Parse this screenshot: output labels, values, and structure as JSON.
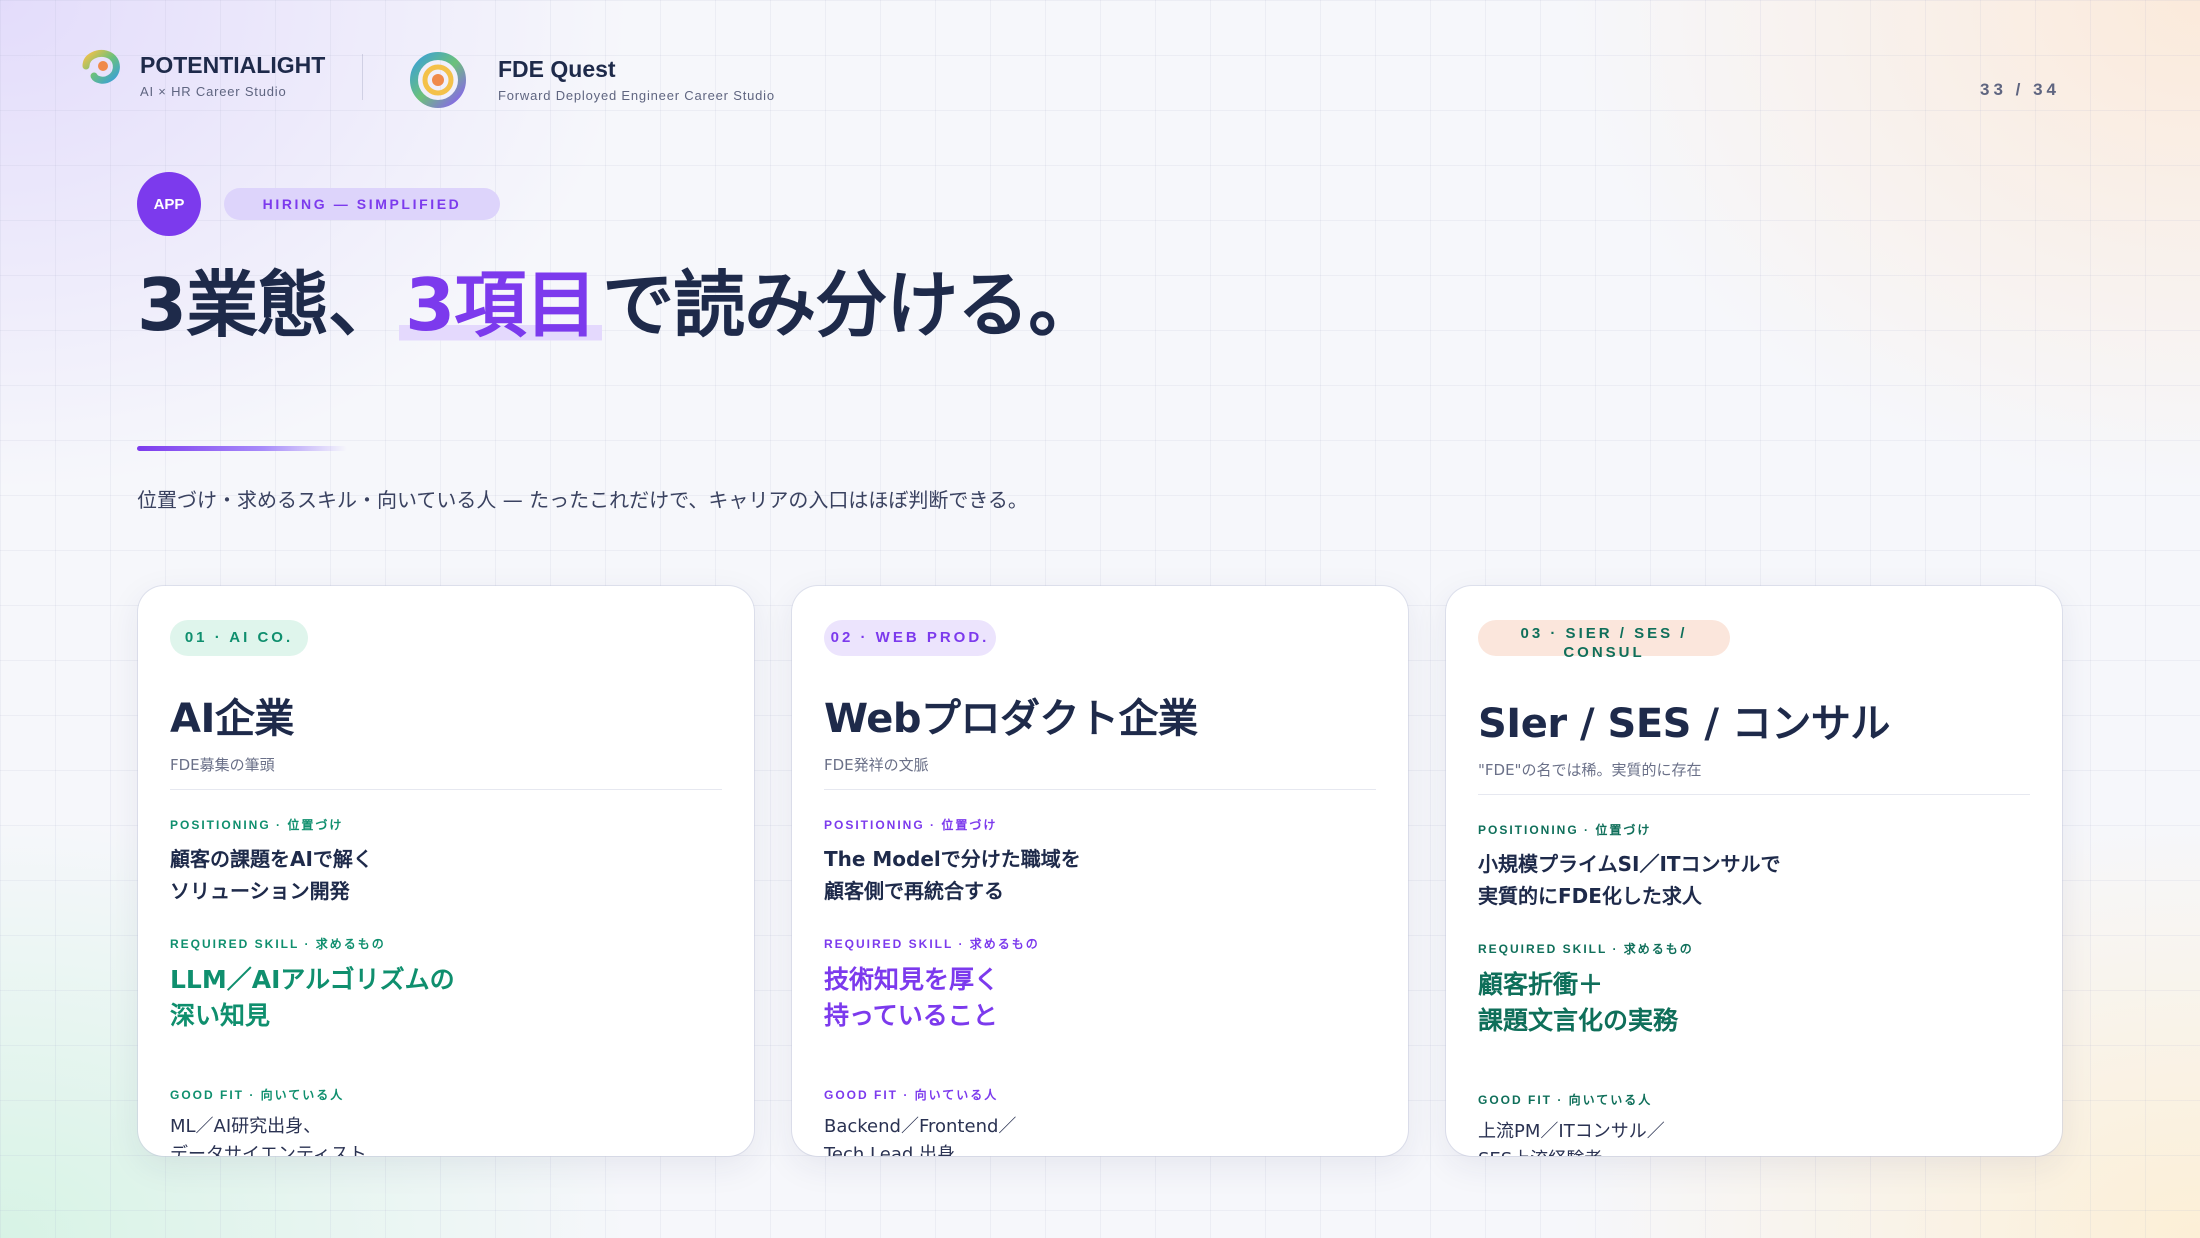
{
  "header": {
    "brand1_name": "POTENTIALIGHT",
    "brand1_sub": "AI × HR Career Studio",
    "brand2_name": "FDE Quest",
    "brand2_sub": "Forward Deployed Engineer Career Studio",
    "page_number": "33 / 34"
  },
  "hero": {
    "badge": "APP",
    "pill": "HIRING — SIMPLIFIED",
    "title_pre": "3業態、",
    "title_highlight": "3項目",
    "title_post": "で読み分ける。",
    "lead": "位置づけ・求めるスキル・向いている人 — たったこれだけで、キャリアの入口はほぼ判断できる。"
  },
  "labels": {
    "positioning": "POSITIONING · 位置づけ",
    "required_skill": "REQUIRED SKILL · 求めるもの",
    "good_fit": "GOOD FIT · 向いている人"
  },
  "cards": [
    {
      "tag": "01 · AI CO.",
      "title": "AI企業",
      "subtitle": "FDE募集の筆頭",
      "positioning": [
        "顧客の課題をAIで解く",
        "ソリューション開発"
      ],
      "skill": [
        "LLM／AIアルゴリズムの",
        "深い知見"
      ],
      "fit": [
        "ML／AI研究出身、",
        "データサイエンティスト"
      ]
    },
    {
      "tag": "02 · WEB PROD.",
      "title": "Webプロダクト企業",
      "subtitle": "FDE発祥の文脈",
      "positioning": [
        "The Modelで分けた職域を",
        "顧客側で再統合する"
      ],
      "skill": [
        "技術知見を厚く",
        "持っていること"
      ],
      "fit": [
        "Backend／Frontend／",
        "Tech Lead 出身"
      ]
    },
    {
      "tag": "03 · SIER / SES / CONSUL",
      "title": "SIer / SES / コンサル",
      "subtitle": "\"FDE\"の名では稀。実質的に存在",
      "positioning": [
        "小規模プライムSI／ITコンサルで",
        "実質的にFDE化した求人"
      ],
      "skill": [
        "顧客折衝＋",
        "課題文言化の実務"
      ],
      "fit": [
        "上流PM／ITコンサル／",
        "SES上流経験者"
      ]
    }
  ],
  "colors": {
    "accent_purple": "#7c3aed",
    "accent_green": "#0f8f6e",
    "accent_teal": "#0f6f5a",
    "navy_text": "#1e2a4a"
  },
  "icons": {
    "brand1_logo": "potentialight-p-logo-icon",
    "brand2_logo": "fde-quest-ring-logo-icon"
  }
}
